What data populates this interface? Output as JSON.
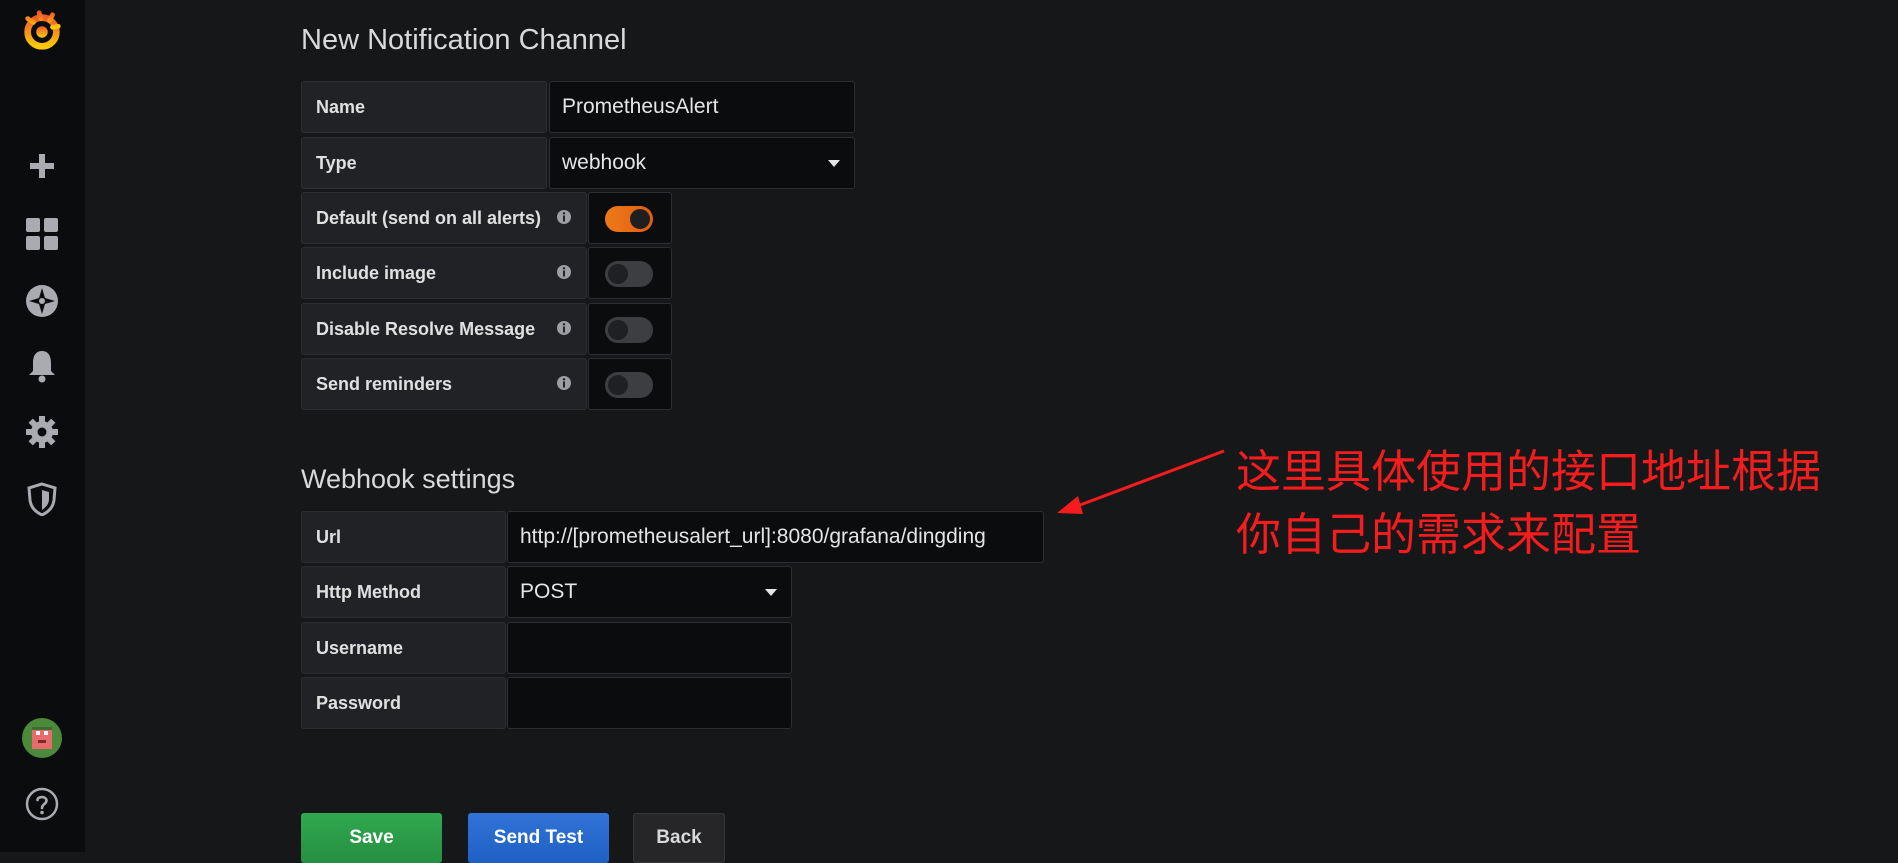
{
  "colors": {
    "accent_orange": "#eb7b18",
    "save_green": "#299c46",
    "test_blue": "#1f60c4",
    "annotation_red": "#f41c1c"
  },
  "sidebar": {
    "icons": [
      "grafana-logo-icon",
      "plus-icon",
      "dashboards-icon",
      "explore-compass-icon",
      "alerting-bell-icon",
      "configuration-gear-icon",
      "server-admin-shield-icon",
      "user-avatar-icon",
      "help-icon"
    ]
  },
  "page": {
    "title": "New Notification Channel"
  },
  "channel": {
    "name_label": "Name",
    "name_value": "PrometheusAlert",
    "type_label": "Type",
    "type_value": "webhook",
    "default_label": "Default (send on all alerts)",
    "default_on": true,
    "image_label": "Include image",
    "image_on": false,
    "resolve_label": "Disable Resolve Message",
    "resolve_on": false,
    "reminders_label": "Send reminders",
    "reminders_on": false
  },
  "webhook": {
    "title": "Webhook settings",
    "url_label": "Url",
    "url_value": "http://[prometheusalert_url]:8080/grafana/dingding",
    "method_label": "Http Method",
    "method_value": "POST",
    "username_label": "Username",
    "username_value": "",
    "password_label": "Password",
    "password_value": ""
  },
  "buttons": {
    "save": "Save",
    "test": "Send Test",
    "back": "Back"
  },
  "annotation": {
    "line1": "这里具体使用的接口地址根据",
    "line2": "你自己的需求来配置"
  }
}
